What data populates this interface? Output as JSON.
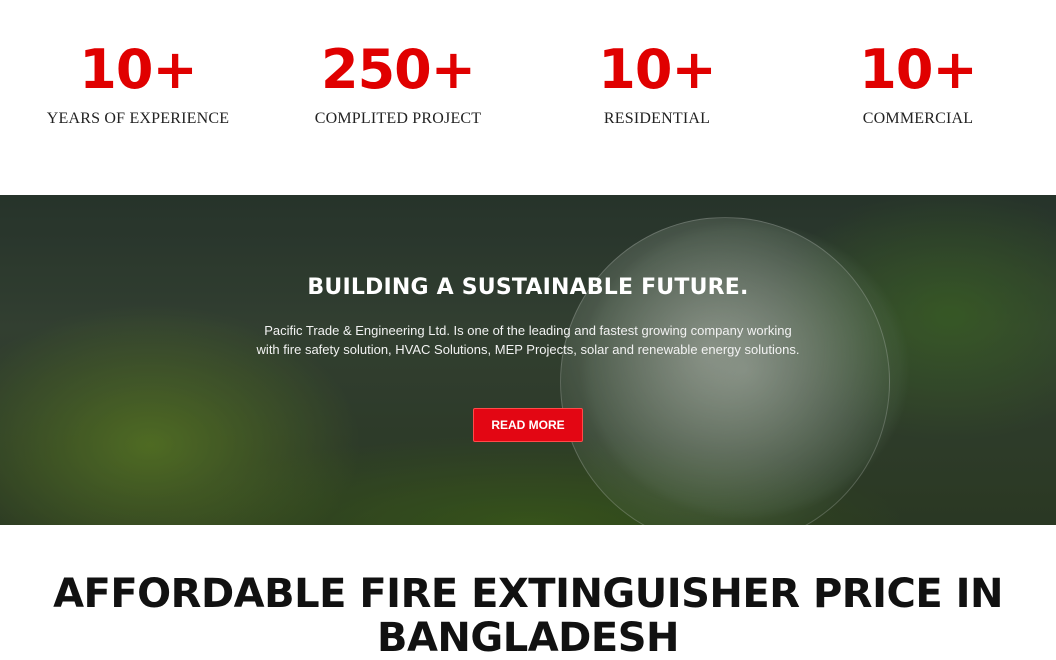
{
  "stats": [
    {
      "number": "10+",
      "label": "YEARS OF EXPERIENCE"
    },
    {
      "number": "250+",
      "label": "COMPLITED PROJECT"
    },
    {
      "number": "10+",
      "label": "RESIDENTIAL"
    },
    {
      "number": "10+",
      "label": "COMMERCIAL"
    }
  ],
  "hero": {
    "title": "BUILDING A SUSTAINABLE FUTURE.",
    "text": "Pacific Trade & Engineering Ltd. Is one of the leading and fastest growing company working with fire safety solution, HVAC Solutions, MEP Projects, solar and renewable energy solutions.",
    "button_label": "READ MORE",
    "image": "green-globe-in-forest"
  },
  "section": {
    "heading_line1": "AFFORDABLE FIRE EXTINGUISHER PRICE IN",
    "heading_line2": "BANGLADESH"
  },
  "colors": {
    "accent": "#e00000",
    "button": "#e30613",
    "text_dark": "#111111"
  }
}
